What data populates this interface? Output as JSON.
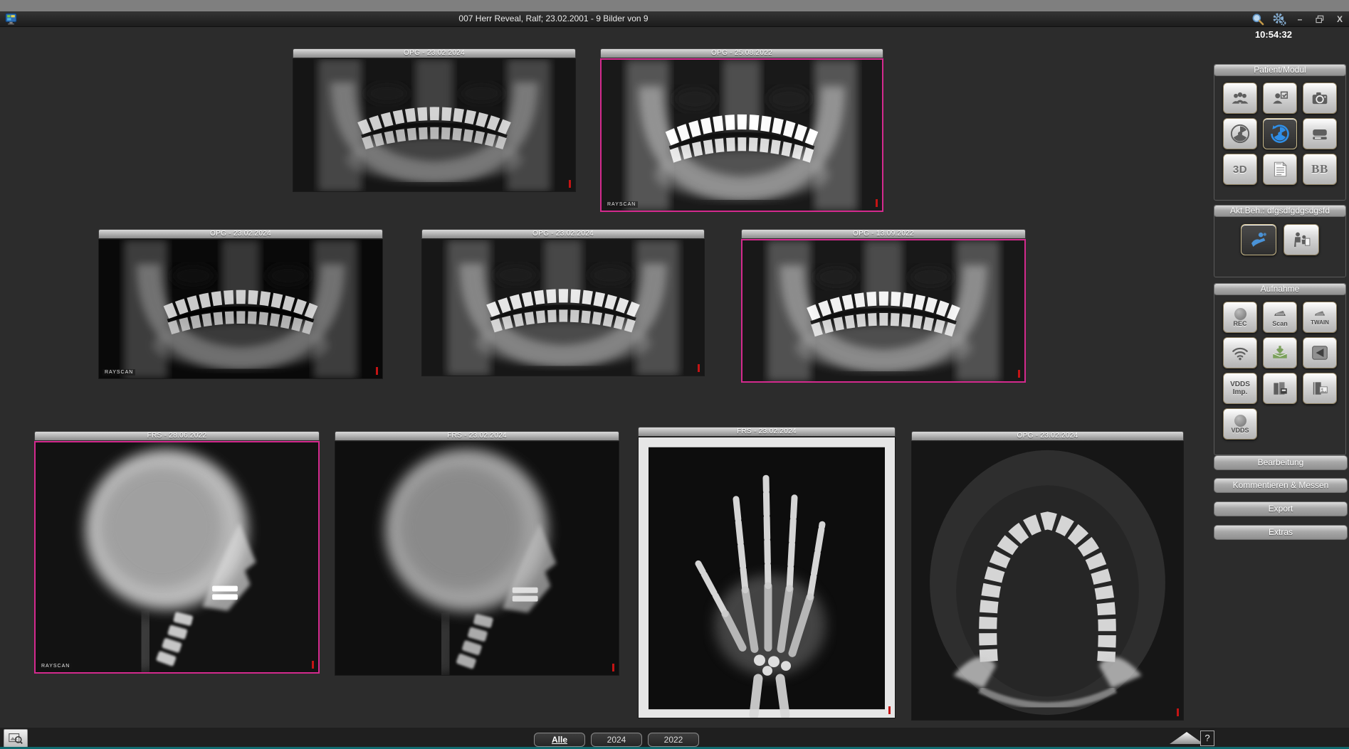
{
  "window": {
    "title": "007 Herr Reveal, Ralf; 23.02.2001 - 9 Bilder von 9",
    "clock": "10:54:32",
    "minimize_label": "–",
    "close_label": "X"
  },
  "sidebar": {
    "patient_section_title": "Patient/Modul",
    "treatment_section_title": "Akt.Beh.: dfgsdfgdgsdgsfd",
    "capture_section_title": "Aufnahme",
    "btn_3d": "3D",
    "btn_bb": "BB",
    "btn_rec": "REC",
    "btn_scan": "Scan",
    "btn_twain": "TWAIN",
    "btn_vdds_imp": "VDDS Imp.",
    "btn_vdds": "VDDS",
    "actions": [
      "Bearbeitung",
      "Kommentieren & Messen",
      "Export",
      "Extras"
    ]
  },
  "thumbnails": [
    {
      "label": "OPG - 23.02.2024",
      "watermark": ""
    },
    {
      "label": "OPG - 25.08.2022",
      "watermark": "RAYSCAN"
    },
    {
      "label": "OPG - 23.02.2024",
      "watermark": "RAYSCAN"
    },
    {
      "label": "OPG - 23.02.2024",
      "watermark": ""
    },
    {
      "label": "OPG - 13.09.2022",
      "watermark": ""
    },
    {
      "label": "FRS - 28.06.2022",
      "watermark": "RAYSCAN"
    },
    {
      "label": "FRS - 23.02.2024",
      "watermark": ""
    },
    {
      "label": "FRS - 23.02.2024",
      "watermark": ""
    },
    {
      "label": "OPG - 23.02.2024",
      "watermark": ""
    }
  ],
  "footer": {
    "tabs": [
      {
        "label": "Alle"
      },
      {
        "label": "2024"
      },
      {
        "label": "2022"
      }
    ],
    "help_label": "?"
  },
  "colors": {
    "selection_pink": "#d42a8e",
    "accent_blue": "#2f8fe8",
    "teal_line": "#0f6a6e"
  }
}
